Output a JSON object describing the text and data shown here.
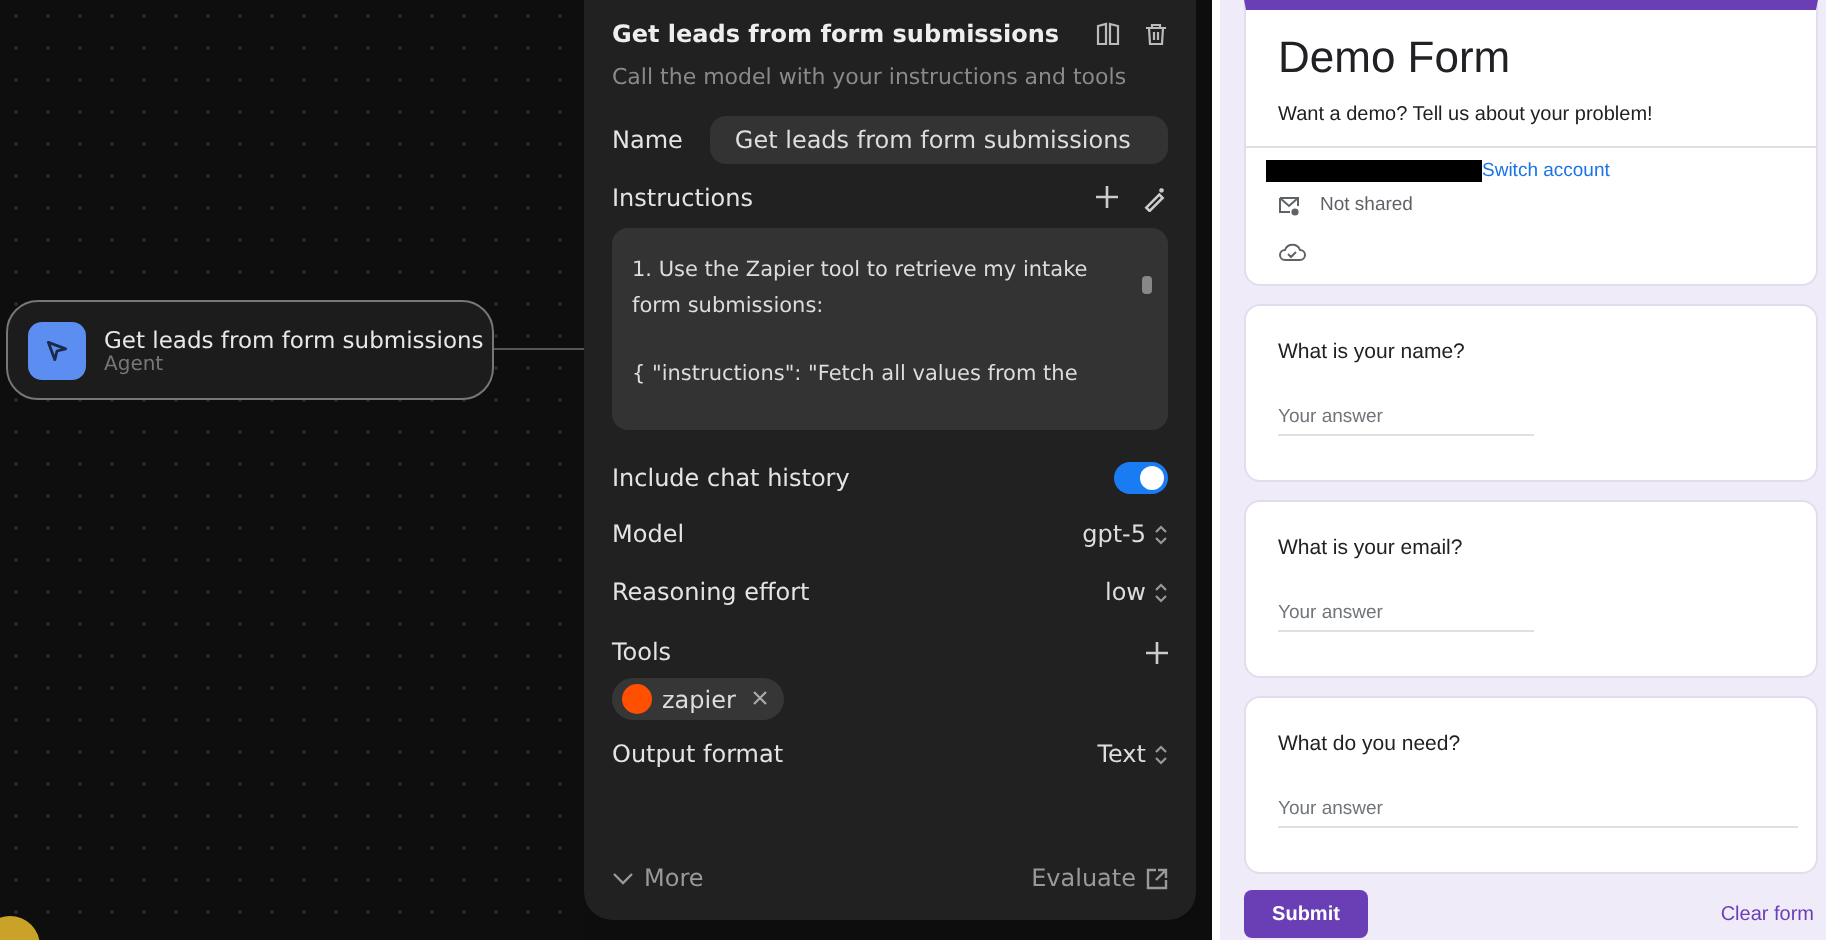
{
  "canvas": {
    "node": {
      "title": "Get leads from form submissions",
      "subtitle": "Agent"
    }
  },
  "panel": {
    "title": "Get leads from form submissions",
    "subtitle": "Call the model with your instructions and tools",
    "name": {
      "label": "Name",
      "value": "Get leads from form submissions"
    },
    "instructions": {
      "label": "Instructions",
      "lines": [
        "1. Use the Zapier tool to retrieve my intake form submissions:",
        "{  \"instructions\": \"Fetch all values from the"
      ]
    },
    "chat_history": {
      "label": "Include chat history",
      "on": true
    },
    "selects": [
      {
        "label": "Model",
        "value": "gpt-5"
      },
      {
        "label": "Reasoning effort",
        "value": "low"
      }
    ],
    "tools": {
      "label": "Tools",
      "items": [
        {
          "label": "zapier"
        }
      ]
    },
    "output_format": {
      "label": "Output format",
      "value": "Text"
    },
    "more": "More",
    "evaluate": "Evaluate"
  },
  "form": {
    "title": "Demo Form",
    "description": "Want a demo? Tell us about your problem!",
    "switch_account": "Switch account",
    "not_shared": "Not shared",
    "questions": [
      {
        "label": "What is your name?",
        "placeholder": "Your answer",
        "wide": false
      },
      {
        "label": "What is your email?",
        "placeholder": "Your answer",
        "wide": false
      },
      {
        "label": "What do you need?",
        "placeholder": "Your answer",
        "wide": true
      }
    ],
    "submit": "Submit",
    "clear": "Clear form"
  }
}
